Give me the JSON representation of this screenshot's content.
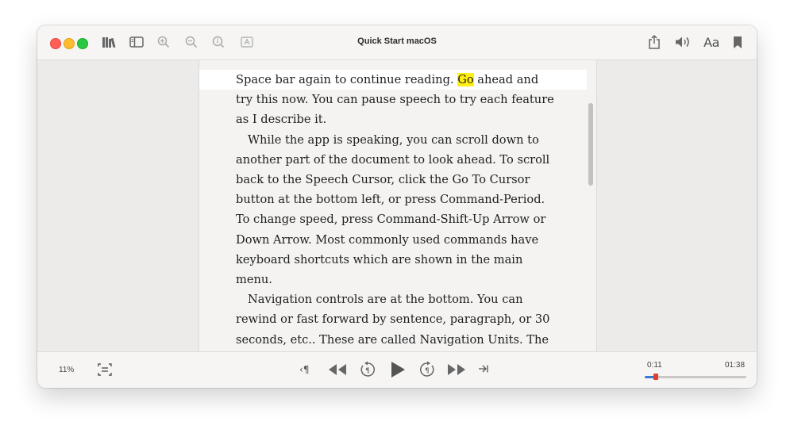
{
  "window": {
    "title": "Quick Start macOS",
    "toolbar": {
      "left_icons": [
        "library-icon",
        "sidebar-icon",
        "zoom-in-icon",
        "zoom-out-icon",
        "info-icon",
        "text-box-icon"
      ],
      "right_icons": [
        "share-icon",
        "speaker-icon",
        "font-icon",
        "bookmark-icon"
      ],
      "font_label": "Aa"
    }
  },
  "reader": {
    "highlight_word": "Go",
    "line1_before": "Space bar again to continue reading. ",
    "line1_after": " ahead and",
    "para1_rest": "try this now. You can pause speech to try each feature as I describe it.",
    "para2": "While the app is speaking, you can scroll down to another part of the document to look ahead. To scroll back to the Speech Cursor, click the Go To Cursor button at the bottom left, or press Command-Period. To change speed, press Command-Shift-Up Arrow or Down Arrow. Most commonly used commands have keyboard shortcuts which are shown in the main menu.",
    "para3": "Navigation controls are at the bottom. You can rewind or fast forward by sentence, paragraph, or 30 seconds, etc.. These are called Navigation Units. The"
  },
  "player": {
    "progress_percent": "11%",
    "current_time": "0:11",
    "total_time": "01:38",
    "progress_fraction": 0.11,
    "nav_unit_label": "¶",
    "accent_color": "#3a78d4",
    "knob_color": "#e0402a",
    "highlight_color": "#ffef14"
  }
}
